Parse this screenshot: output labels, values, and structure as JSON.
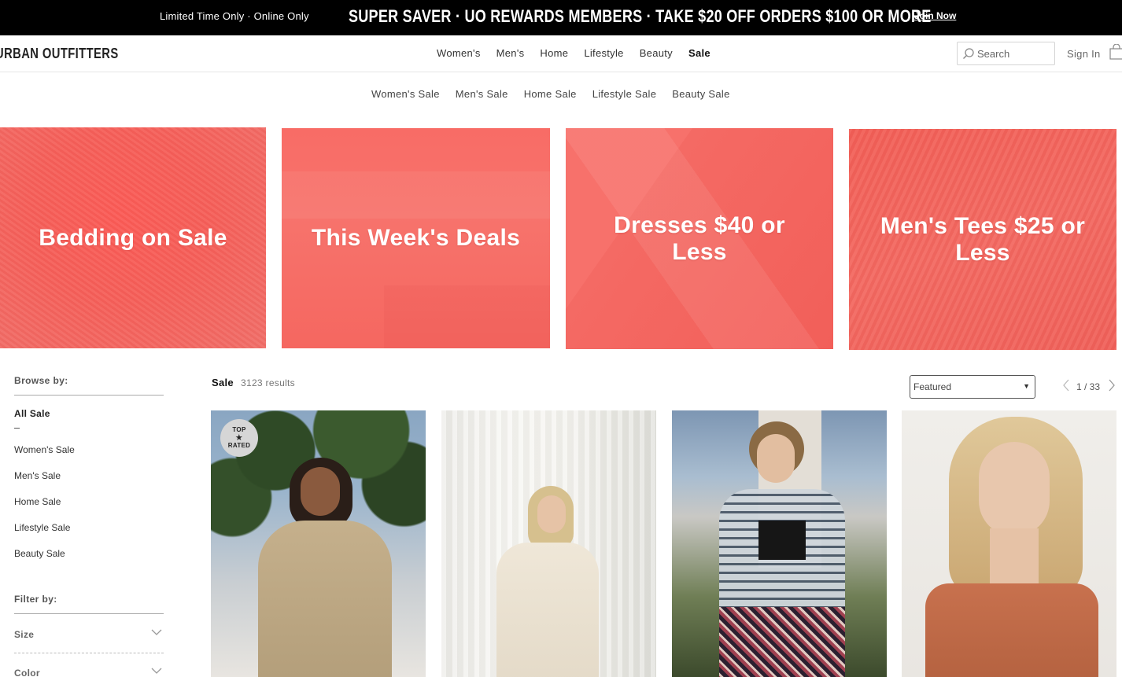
{
  "promo": {
    "left_text": "Limited Time Only · Online Only",
    "main_text": "SUPER SAVER · UO REWARDS MEMBERS · TAKE $20 OFF ORDERS $100 OR MORE",
    "join_label": "Join Now"
  },
  "header": {
    "logo": "URBAN OUTFITTERS",
    "nav": [
      "Women's",
      "Men's",
      "Home",
      "Lifestyle",
      "Beauty",
      "Sale"
    ],
    "search_placeholder": "Search",
    "sign_in": "Sign In"
  },
  "sub_nav": [
    "Women's Sale",
    "Men's Sale",
    "Home Sale",
    "Lifestyle Sale",
    "Beauty Sale"
  ],
  "hero_tiles": [
    {
      "title": "Bedding on Sale"
    },
    {
      "title": "This Week's Deals"
    },
    {
      "title": "Dresses $40 or Less"
    },
    {
      "title": "Men's Tees $25 or Less"
    }
  ],
  "colors": {
    "promo_bg": "#000000",
    "tile_coral": "#f66a63"
  },
  "sidebar": {
    "browse_heading": "Browse by:",
    "all_sale": "All Sale",
    "links": [
      "Women's Sale",
      "Men's Sale",
      "Home Sale",
      "Lifestyle Sale",
      "Beauty Sale"
    ],
    "filter_heading": "Filter by:",
    "filters": [
      "Size",
      "Color"
    ]
  },
  "results": {
    "title": "Sale",
    "count": "3123 results",
    "sort_selected": "Featured",
    "page": "1 / 33"
  },
  "products": [
    {
      "badge_top": "TOP",
      "badge_star": "★",
      "badge_bottom": "RATED"
    }
  ]
}
